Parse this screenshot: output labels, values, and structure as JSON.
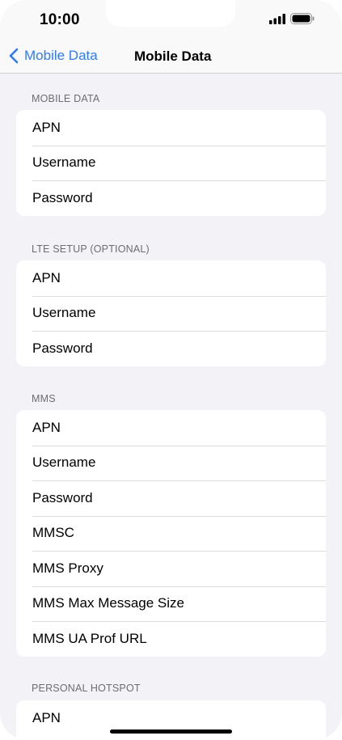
{
  "status_bar": {
    "time": "10:00"
  },
  "nav": {
    "back_label": "Mobile Data",
    "title": "Mobile Data"
  },
  "sections": [
    {
      "header": "MOBILE DATA",
      "rows": [
        "APN",
        "Username",
        "Password"
      ]
    },
    {
      "header": "LTE SETUP (OPTIONAL)",
      "rows": [
        "APN",
        "Username",
        "Password"
      ]
    },
    {
      "header": "MMS",
      "rows": [
        "APN",
        "Username",
        "Password",
        "MMSC",
        "MMS Proxy",
        "MMS Max Message Size",
        "MMS UA Prof URL"
      ]
    },
    {
      "header": "PERSONAL HOTSPOT",
      "rows": [
        "APN"
      ]
    }
  ],
  "colors": {
    "accent": "#2f7cf6",
    "background": "#f2f2f7",
    "card": "#ffffff"
  },
  "icons": {
    "back": "chevron-left-icon",
    "signal": "cellular-signal-icon",
    "battery": "battery-icon"
  }
}
